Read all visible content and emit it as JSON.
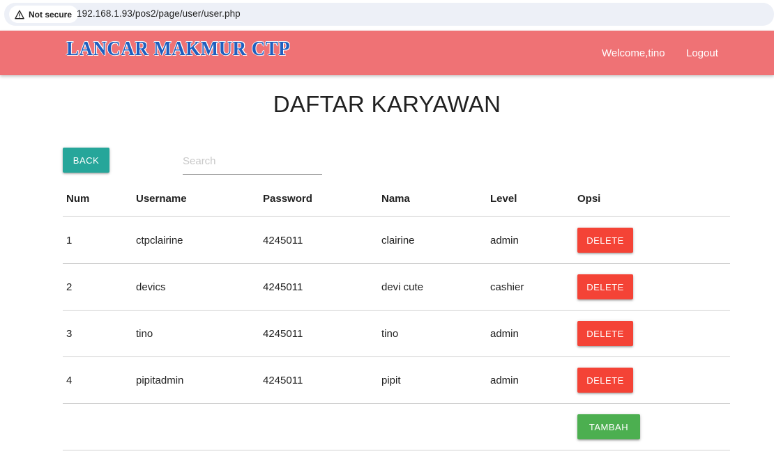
{
  "browser": {
    "security_label": "Not secure",
    "url": "192.168.1.93/pos2/page/user/user.php"
  },
  "navbar": {
    "brand": "LANCAR MAKMUR CTP",
    "welcome": "Welcome,tino",
    "logout": "Logout",
    "color": "#ef7275",
    "brand_color": "#1f5fbe"
  },
  "page": {
    "title": "DAFTAR KARYAWAN",
    "back_label": "BACK",
    "search_placeholder": "Search",
    "search_value": ""
  },
  "table": {
    "headers": {
      "num": "Num",
      "username": "Username",
      "password": "Password",
      "nama": "Nama",
      "level": "Level",
      "opsi": "Opsi"
    },
    "rows": [
      {
        "num": "1",
        "username": "ctpclairine",
        "password": "4245011",
        "nama": "clairine",
        "level": "admin",
        "action": "DELETE"
      },
      {
        "num": "2",
        "username": "devics",
        "password": "4245011",
        "nama": "devi cute",
        "level": "cashier",
        "action": "DELETE"
      },
      {
        "num": "3",
        "username": "tino",
        "password": "4245011",
        "nama": "tino",
        "level": "admin",
        "action": "DELETE"
      },
      {
        "num": "4",
        "username": "pipitadmin",
        "password": "4245011",
        "nama": "pipit",
        "level": "admin",
        "action": "DELETE"
      }
    ],
    "add_label": "TAMBAH"
  },
  "colors": {
    "back_button": "#26a69a",
    "delete_button": "#f44336",
    "add_button": "#4caf50"
  }
}
